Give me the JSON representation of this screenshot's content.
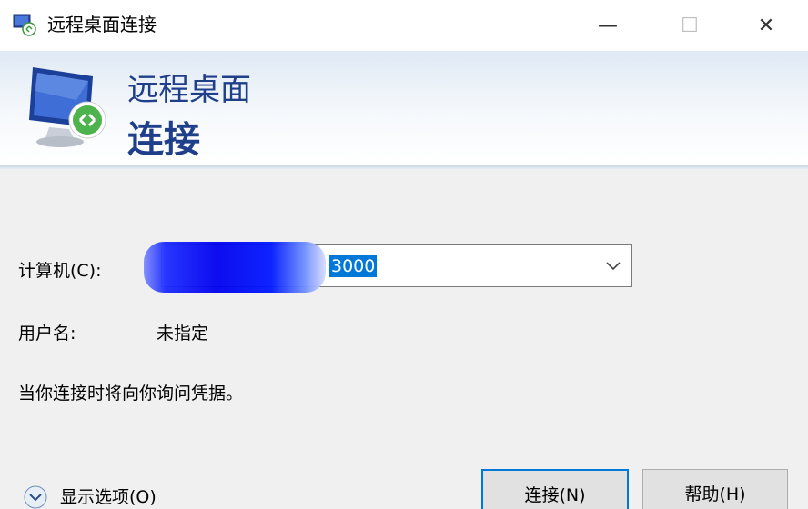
{
  "window": {
    "title": "远程桌面连接",
    "minimize_glyph": "—",
    "maximize_glyph": "☐",
    "close_glyph": "✕"
  },
  "banner": {
    "line1": "远程桌面",
    "line2": "连接"
  },
  "form": {
    "computer_label": "计算机(C):",
    "computer_value_visible": "3000",
    "username_label": "用户名:",
    "username_value": "未指定",
    "credentials_note": "当你连接时将向你询问凭据。"
  },
  "footer": {
    "show_options_label": "显示选项(O)",
    "connect_button": "连接(N)",
    "help_button": "帮助(H)"
  },
  "colors": {
    "accent": "#0078d7",
    "banner_text": "#1f3f8a"
  },
  "icons": {
    "app": "remote-desktop-icon",
    "banner": "monitor-connection-icon",
    "dropdown": "chevron-down-icon",
    "options": "chevron-circle-down-icon"
  }
}
